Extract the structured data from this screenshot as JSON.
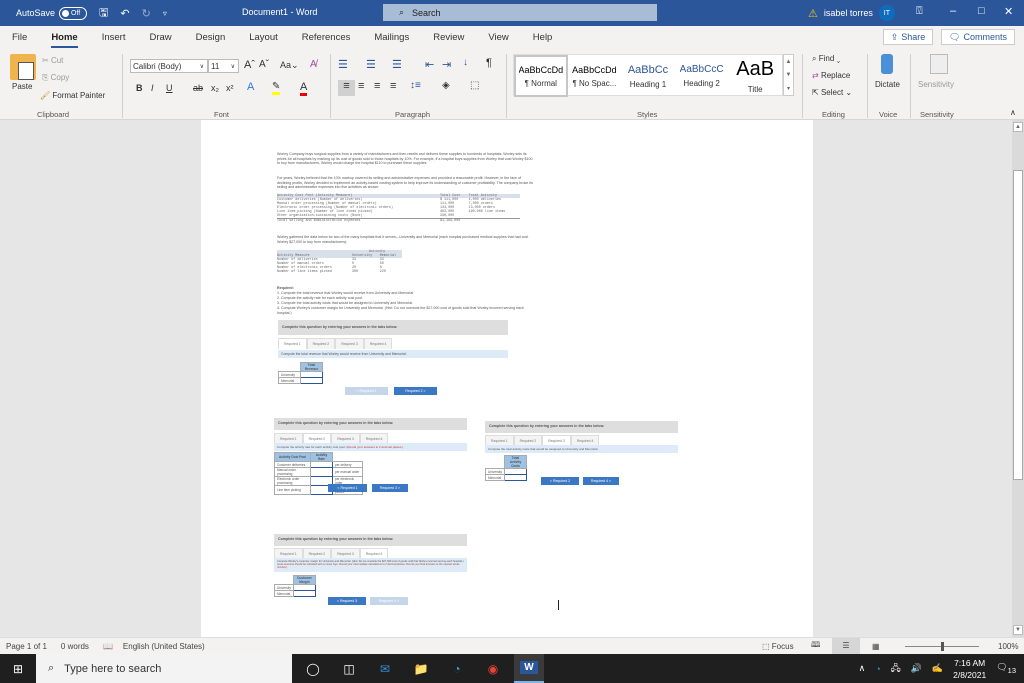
{
  "titlebar": {
    "autosave_label": "AutoSave",
    "autosave_state": "Off",
    "doc_title": "Document1  -  Word",
    "search_placeholder": "Search",
    "user_name": "isabel torres",
    "user_initials": "IT"
  },
  "menu": {
    "items": [
      "File",
      "Home",
      "Insert",
      "Draw",
      "Design",
      "Layout",
      "References",
      "Mailings",
      "Review",
      "View",
      "Help"
    ],
    "active": "Home",
    "share_label": "Share",
    "comments_label": "Comments"
  },
  "ribbon": {
    "clipboard": {
      "paste": "Paste",
      "cut": "Cut",
      "copy": "Copy",
      "format_painter": "Format Painter",
      "label": "Clipboard"
    },
    "font": {
      "family": "Calibri (Body)",
      "size": "11",
      "label": "Font"
    },
    "paragraph": {
      "label": "Paragraph"
    },
    "styles": {
      "items": [
        {
          "preview": "AaBbCcDd",
          "name": "¶ Normal"
        },
        {
          "preview": "AaBbCcDd",
          "name": "¶ No Spac..."
        },
        {
          "preview": "AaBbCc",
          "name": "Heading 1"
        },
        {
          "preview": "AaBbCcC",
          "name": "Heading 2"
        },
        {
          "preview": "AaB",
          "name": "Title"
        }
      ],
      "label": "Styles"
    },
    "editing": {
      "find": "Find",
      "replace": "Replace",
      "select": "Select",
      "label": "Editing"
    },
    "voice": {
      "dictate": "Dictate",
      "label": "Voice"
    },
    "sensitivity": {
      "button": "Sensitivity",
      "label": "Sensitivity"
    }
  },
  "document": {
    "para1": "Worley Company buys surgical supplies from a variety of manufacturers and then resells and delivers these supplies to hundreds of hospitals. Worley sets its prices for all hospitals by marking up its cost of goods sold to those hospitals by 10%. For example, if a hospital buys supplies from Worley that cost Worley $100 to buy from manufacturers, Worley would charge the hospital $110 to purchase these supplies.",
    "para2": "For years, Worley believed that the 10% markup covered its selling and administrative expenses and provided a reasonable profit. However, in the face of declining profits, Worley decided to implement an activity-based costing system to help improve its understanding of customer profitability. The company broke its selling and administrative expenses into five activities as shown:",
    "activity_table": {
      "headers": [
        "Activity Cost Pool (Activity Measure)",
        "Total Cost",
        "Total Activity"
      ],
      "rows": [
        [
          "Customer deliveries (Number of deliveries)",
          "$ 111,000",
          "4,000 deliveries"
        ],
        [
          "Manual order processing (Number of manual orders)",
          "111,000",
          "7,000 orders"
        ],
        [
          "Electronic order processing (Number of electronic orders)",
          "134,000",
          "13,000 orders"
        ],
        [
          "Line item picking (Number of line items picked)",
          "483,000",
          "490,000 line items"
        ],
        [
          "Other organization-sustaining costs (None)",
          "330,000",
          ""
        ],
        [
          "Total selling and administrative expenses",
          "$1,199,000",
          ""
        ]
      ]
    },
    "para3": "Worley gathered the data below for two of the many hospitals that it serves—University and Memorial (each hospital purchased medical supplies that had cost Worley $27,000 to buy from manufacturers):",
    "hospital_table": {
      "group_header": "Activity",
      "headers": [
        "Activity Measure",
        "University",
        "Memorial"
      ],
      "rows": [
        [
          "Number of deliveries",
          "33",
          "33"
        ],
        [
          "Number of manual orders",
          "0",
          "50"
        ],
        [
          "Number of electronic orders",
          "20",
          "0"
        ],
        [
          "Number of line items picked",
          "300",
          "220"
        ]
      ]
    },
    "required_title": "Required:",
    "required_items": [
      "1. Compute the total revenue that Worley would receive from University and Memorial.",
      "2. Compute the activity rate for each activity cost pool.",
      "3. Compute the total activity costs that would be assigned to University and Memorial.",
      "4. Compute Worley's customer margin for University and Memorial. (Hint: Do not overlook the $27,000 cost of goods sold that Worley incurred serving each hospital.)"
    ],
    "panels": [
      {
        "prompt": "Complete this question by entering your answers in the tabs below.",
        "tabs": [
          "Required 1",
          "Required 2",
          "Required 3",
          "Required 4"
        ],
        "active_tab": 0,
        "instruction": "Compute the total revenue that Worley would receive from University and Memorial.",
        "instruction_red": "",
        "col_header": "Total Revenue",
        "rows": [
          "University",
          "Memorial"
        ],
        "prev_label": "< Required 1",
        "next_label": "Required 2 >"
      },
      {
        "prompt": "Complete this question by entering your answers in the tabs below.",
        "tabs": [
          "Required 1",
          "Required 2",
          "Required 3",
          "Required 4"
        ],
        "active_tab": 1,
        "instruction": "Compute the activity rate for each activity cost pool.",
        "instruction_red": "(Round your answers to 2 decimal places.)",
        "col_header_left": "Activity Cost Pool",
        "col_header": "Activity Rate",
        "rows": [
          {
            "label": "Customer deliveries",
            "unit": "per delivery"
          },
          {
            "label": "Manual order processing",
            "unit": "per manual order"
          },
          {
            "label": "Electronic order processing",
            "unit": "per electronic order"
          },
          {
            "label": "Line item picking",
            "unit": "per line item picked"
          }
        ],
        "prev_label": "< Required 1",
        "next_label": "Required 3 >"
      },
      {
        "prompt": "Complete this question by entering your answers in the tabs below.",
        "tabs": [
          "Required 1",
          "Required 2",
          "Required 3",
          "Required 4"
        ],
        "active_tab": 2,
        "instruction": "Compute the total activity costs that would be assigned to University and Memorial.",
        "instruction_red": "",
        "col_header": "Total Activity Costs",
        "rows": [
          "University",
          "Memorial"
        ],
        "prev_label": "< Required 2",
        "next_label": "Required 4 >"
      },
      {
        "prompt": "Complete this question by entering your answers in the tabs below.",
        "tabs": [
          "Required 1",
          "Required 2",
          "Required 3",
          "Required 4"
        ],
        "active_tab": 3,
        "instruction": "Compute Worley's customer margin for University and Memorial. (Hint: Do not overlook the $27,000 cost of goods sold that Worley incurred serving each hospital.)",
        "instruction_red": "(Loss amounts should be indicated with a minus sign. Round your intermediate calculations to 2 decimal places. Round your final answers to the nearest whole number.)",
        "col_header": "Customer Margin",
        "rows": [
          "University",
          "Memorial"
        ],
        "prev_label": "< Required 3",
        "next_label": "Required 4 >"
      }
    ]
  },
  "statusbar": {
    "page": "Page 1 of 1",
    "words": "0 words",
    "language": "English (United States)",
    "focus": "Focus",
    "zoom": "100%"
  },
  "taskbar": {
    "search_placeholder": "Type here to search",
    "time": "7:16 AM",
    "date": "2/8/2021",
    "notifications": "13"
  }
}
